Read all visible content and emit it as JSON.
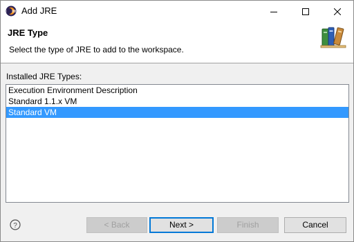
{
  "window": {
    "title": "Add JRE",
    "icon": "eclipse-icon",
    "controls": [
      "minimize-icon",
      "maximize-icon",
      "close-icon"
    ]
  },
  "banner": {
    "title": "JRE Type",
    "description": "Select the type of JRE to add to the workspace.",
    "icon": "books-icon"
  },
  "jre_list": {
    "label": "Installed JRE Types:",
    "items": [
      {
        "label": "Execution Environment Description",
        "selected": false
      },
      {
        "label": "Standard 1.1.x VM",
        "selected": false
      },
      {
        "label": "Standard VM",
        "selected": true
      }
    ]
  },
  "footer": {
    "help_icon": "help-icon",
    "back_label": "< Back",
    "next_label": "Next >",
    "finish_label": "Finish",
    "cancel_label": "Cancel"
  },
  "colors": {
    "selection": "#3399ff",
    "default_button_border": "#0078d7"
  }
}
